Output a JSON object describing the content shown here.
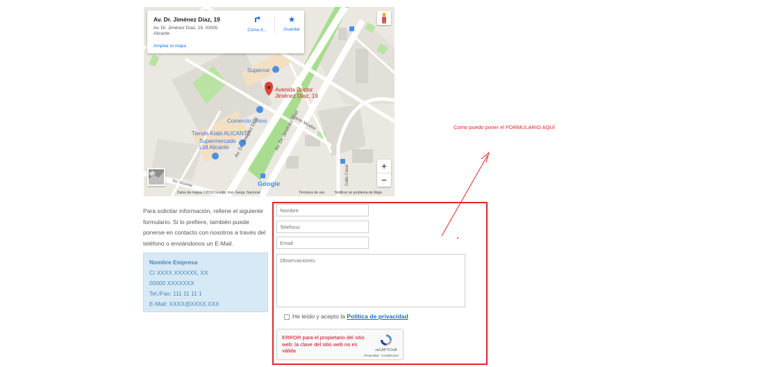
{
  "map": {
    "place_name": "Av. Dr. Jiménez Díaz, 19",
    "place_address": "Av. Dr. Jiménez Díaz, 19, 03005 Alicante",
    "directions_label": "Cómo ll...",
    "save_label": "Guardar",
    "enlarge_link": "Ampliar el mapa",
    "zoom_in": "+",
    "zoom_out": "−",
    "pin_label_line1": "Avenida Doctor",
    "pin_label_line2": "Jiménez Díaz, 19",
    "poi_supercor": "Supercor",
    "poi_comercio": "Comercio Chino",
    "poi_kiabi": "Tienda Kiabi ALICANTE",
    "poi_lidl_line1": "Supermercado",
    "poi_lidl_line2": "Lidl Alicante",
    "street_1": "Av. Dr. Jiménez Díaz",
    "street_2": "Av. Dr. Jiménez Díaz",
    "street_3": "Carrer Mirafior",
    "street_4": "Calle Casal",
    "street_5": "Av. Vicente",
    "google_logo": "Google",
    "attribution": "Datos de mapas ©2018 Google, Inst. Geogr. Nacional",
    "terms": "Términos de uso",
    "report": "Notificar un problema de Maps",
    "colors": {
      "green": "#a8dd8f",
      "road": "#ffffff",
      "block": "#d8d6d0",
      "pin": "#db4437",
      "poi_blue": "#4a90e2"
    },
    "icons": {
      "directions": "directions-icon",
      "save": "star-icon",
      "pegman": "pegman-icon",
      "pin": "map-pin-icon"
    }
  },
  "intro_text": "Para solicitar información, rellene el siguiente formulario. Si lo prefiere, también puede ponerse en contacto con nosotros a través del teléfono o enviándonos un E-Mail.",
  "company": {
    "name": "Nombre Empresa",
    "address": "C/ XXXX XXXXXX, XX",
    "city": "00000 XXXXXXX",
    "phone": "Tel./Fax: 111 11 11 1",
    "email": "E-Mail: XXXX@XXXX.XXX"
  },
  "form": {
    "name_placeholder": "Nombre",
    "phone_placeholder": "Teléfono",
    "email_placeholder": "Email",
    "notes_placeholder": "Observaciones",
    "privacy_prefix": "He leído y acepto la ",
    "privacy_link": "Política de privacidad",
    "recaptcha_error": "ERROR para el propietario del sitio web: la clave del sitio web no es válida",
    "recaptcha_name": "reCAPTCHA",
    "recaptcha_terms": "Privacidad - Condiciones"
  },
  "annotation": {
    "text": "Como puedo poner el FORMULARIO AQUÍ",
    "color": "#e2232b"
  }
}
